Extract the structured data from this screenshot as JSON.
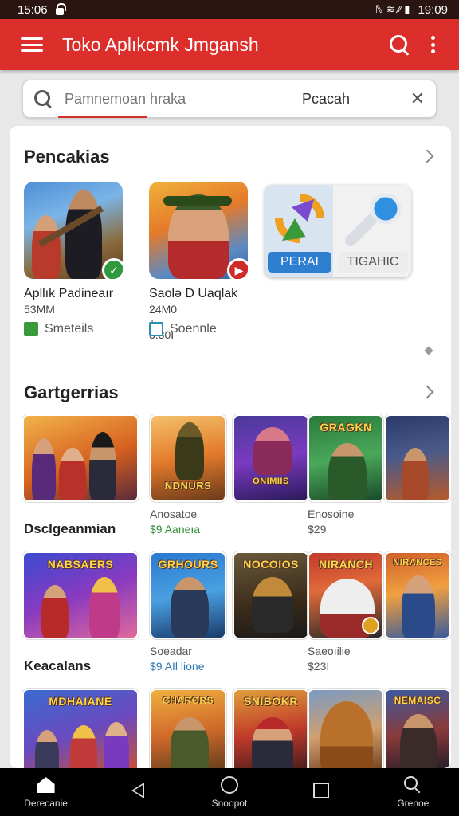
{
  "status": {
    "time_left": "15:06",
    "time_right": "19:09",
    "icons_text": "ℕ ≋ ∕∕ ▮"
  },
  "appbar": {
    "title": "Toko Aplıkcmk Jmgansh"
  },
  "search": {
    "placeholder": "Pamnemoan hraka",
    "button_label": "Pcacah",
    "clear_glyph": "✕"
  },
  "featured": {
    "title": "Pencakias",
    "items": [
      {
        "name": "Apllık Padineaır",
        "size": "53MM",
        "tag": "Smeteils",
        "tag_color": "#3a9b3a",
        "badge": "✓",
        "badge_color": "#2f9a3d"
      },
      {
        "name": "Saolə D Uaqlak",
        "size": "24M0 + 3.80I",
        "tag": "Soennle",
        "tag_color": "#2a8fb5",
        "badge": "▶",
        "badge_color": "#d12a2a"
      }
    ],
    "promo": {
      "left_label": "PERAI",
      "right_label": "TIGAHIC"
    }
  },
  "categories": {
    "title": "Gartgerrias",
    "rows": [
      {
        "label": "Dsclgeanmian",
        "tiles": [
          "",
          "NDNURS",
          "ONIMIIS",
          "GRAGKN",
          ""
        ],
        "meta": [
          {
            "name": "Anosatoe",
            "price": "$9 Aaneıa"
          },
          {
            "name": "Enosoine",
            "price": "$29"
          }
        ]
      },
      {
        "label": "Keacalans",
        "tiles": [
          "NABSAERS",
          "GRHOURS",
          "NOCOIOS",
          "NIRANCH",
          "NIRANCES"
        ],
        "meta": [
          {
            "name": "Soeadar",
            "price": "$9 AIl lione"
          },
          {
            "name": "Saeoıilie",
            "price": "$23I"
          }
        ]
      },
      {
        "label": "",
        "tiles": [
          "MDHAIANE",
          "CHARORS",
          "SNIBOKR",
          "",
          "NEMAISC"
        ],
        "meta": []
      }
    ]
  },
  "navbar": {
    "items": [
      {
        "label": "Derecanie",
        "icon": "home-icon"
      },
      {
        "label": "",
        "icon": "back-icon"
      },
      {
        "label": "Snoopot",
        "icon": "refresh-icon"
      },
      {
        "label": "",
        "icon": "recent-icon"
      },
      {
        "label": "Grenoe",
        "icon": "search-icon"
      }
    ]
  }
}
